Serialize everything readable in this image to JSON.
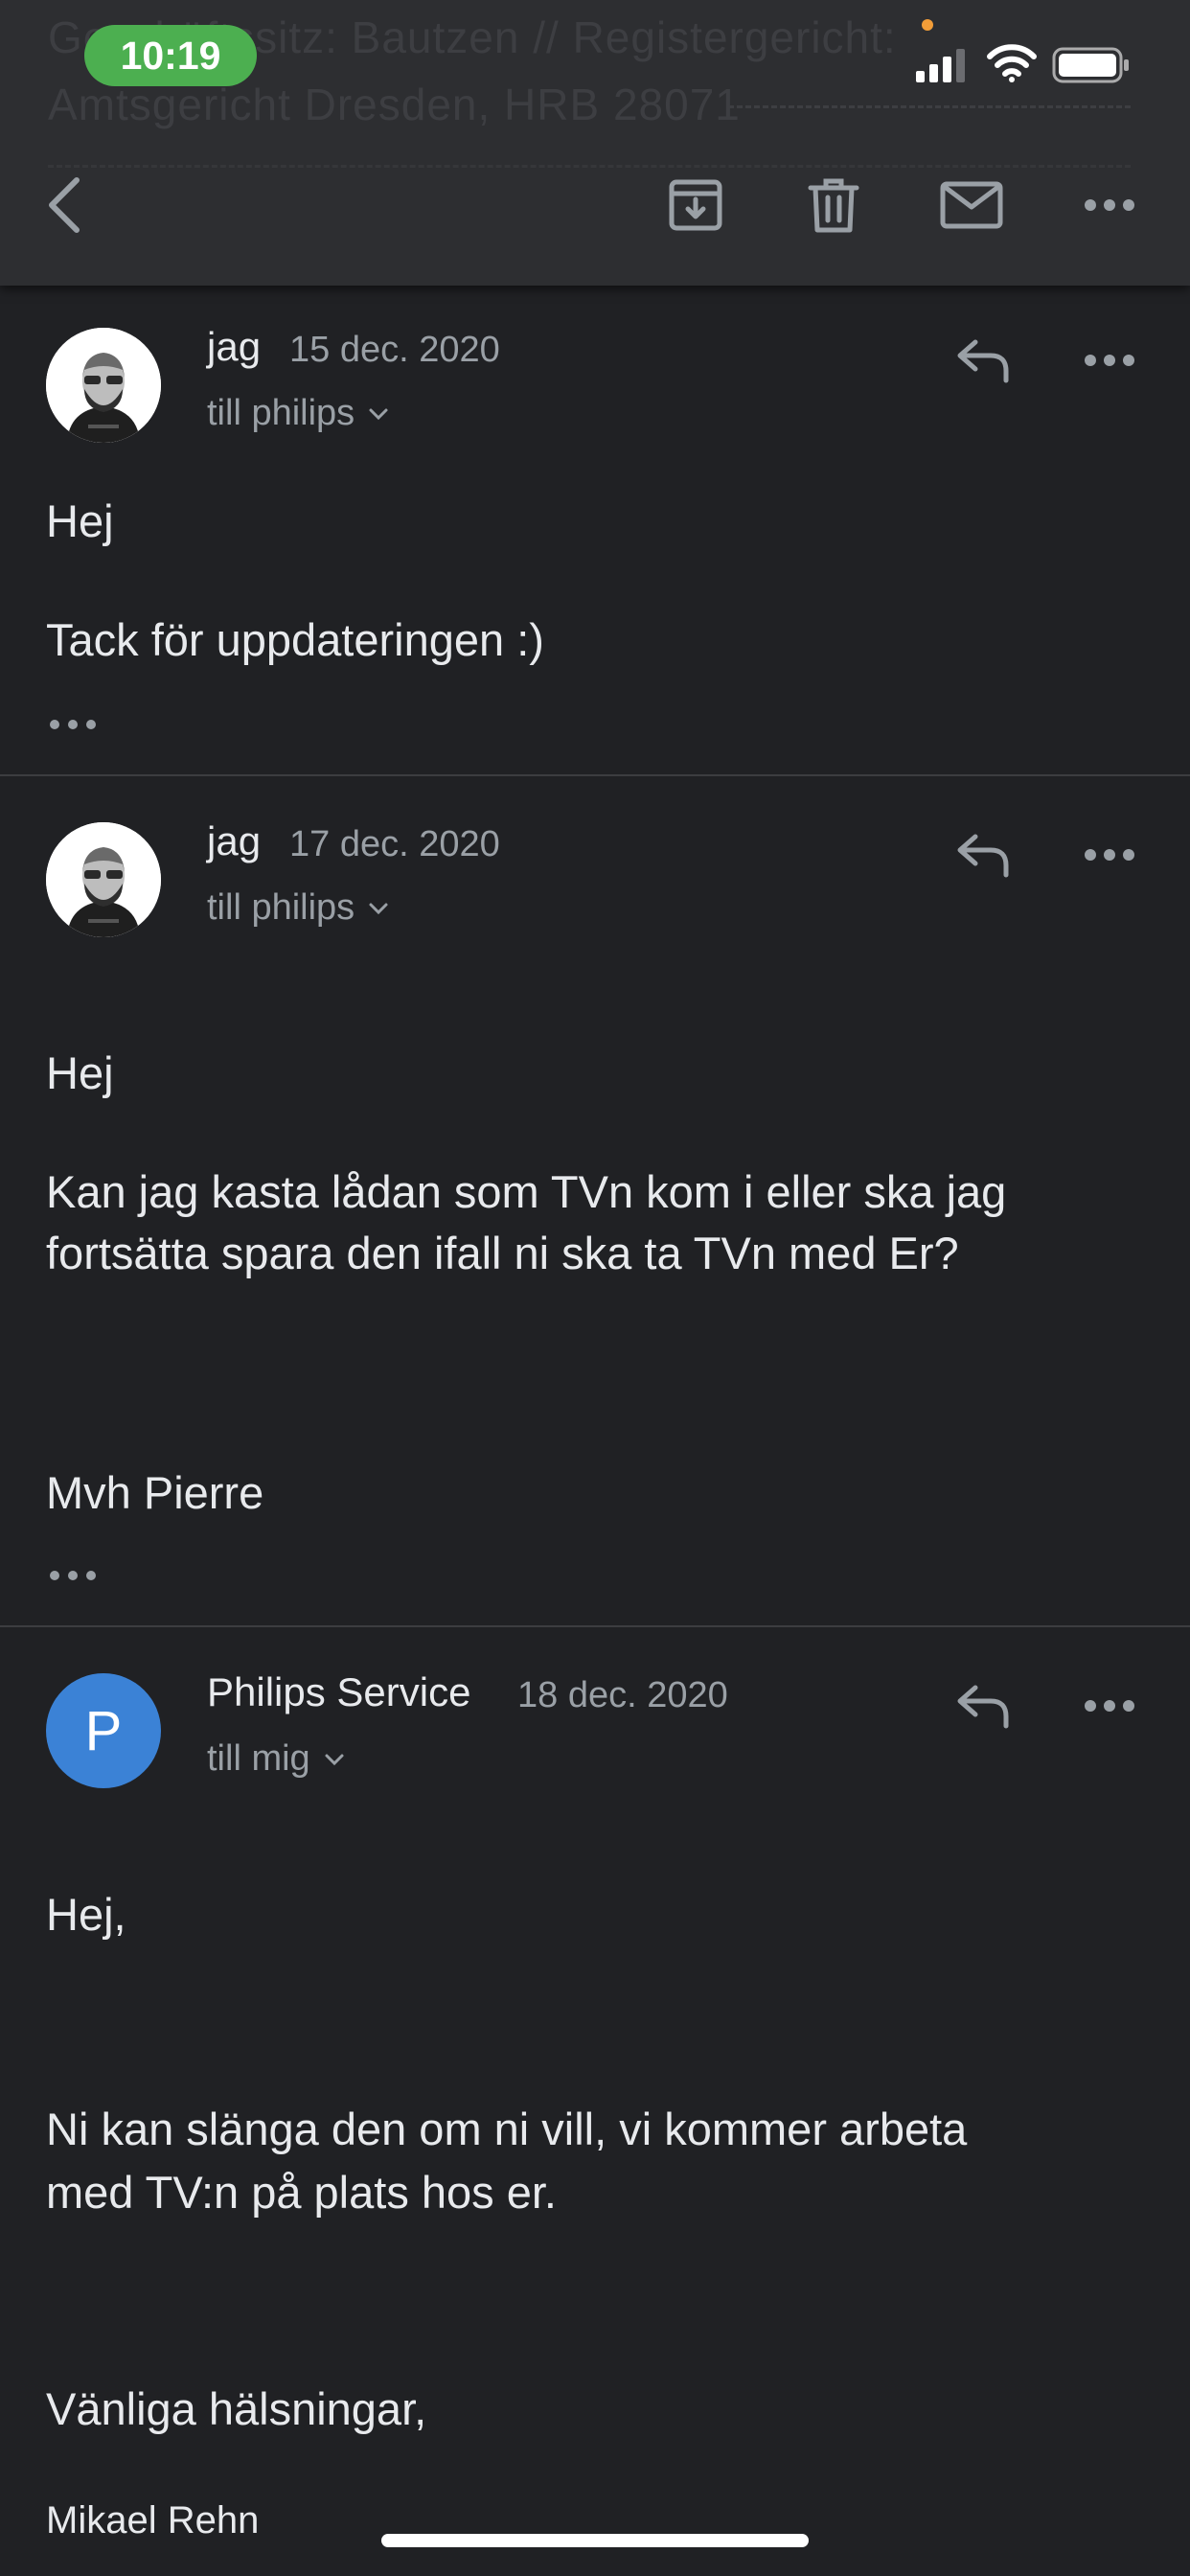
{
  "status_bar": {
    "time": "10:19"
  },
  "background_header": {
    "line1": "Geschäftssitz: Bautzen // Registergericht:",
    "line2": "Amtsgericht Dresden, HRB 28071"
  },
  "toolbar": {
    "back_icon": "chevron-left-icon",
    "archive_icon": "archive-icon",
    "delete_icon": "trash-icon",
    "mark_unread_icon": "mail-icon",
    "more_icon": "more-horizontal-icon"
  },
  "messages": [
    {
      "sender": "jag",
      "date": "15 dec. 2020",
      "recipient": "till philips",
      "body": [
        "Hej",
        "Tack för uppdateringen :)"
      ]
    },
    {
      "sender": "jag",
      "date": "17 dec. 2020",
      "recipient": "till philips",
      "body": [
        "Hej",
        "Kan jag kasta lådan som TVn kom i eller ska jag",
        "fortsätta spara den ifall ni ska ta TVn med Er?",
        "Mvh Pierre"
      ]
    },
    {
      "sender": "Philips Service",
      "date": "18 dec. 2020",
      "recipient": "till mig",
      "avatar_letter": "P",
      "body": [
        "Hej,",
        "Ni kan slänga den om ni vill, vi kommer arbeta",
        "med TV:n på plats hos er.",
        "Vänliga hälsningar,",
        "Mikael Rehn"
      ]
    }
  ],
  "colors": {
    "background": "#202124",
    "toolbar": "#2d2e31",
    "time_pill": "#4caf50",
    "avatar_blue": "#3b82d6",
    "secondary_text": "#9aa0a6"
  }
}
